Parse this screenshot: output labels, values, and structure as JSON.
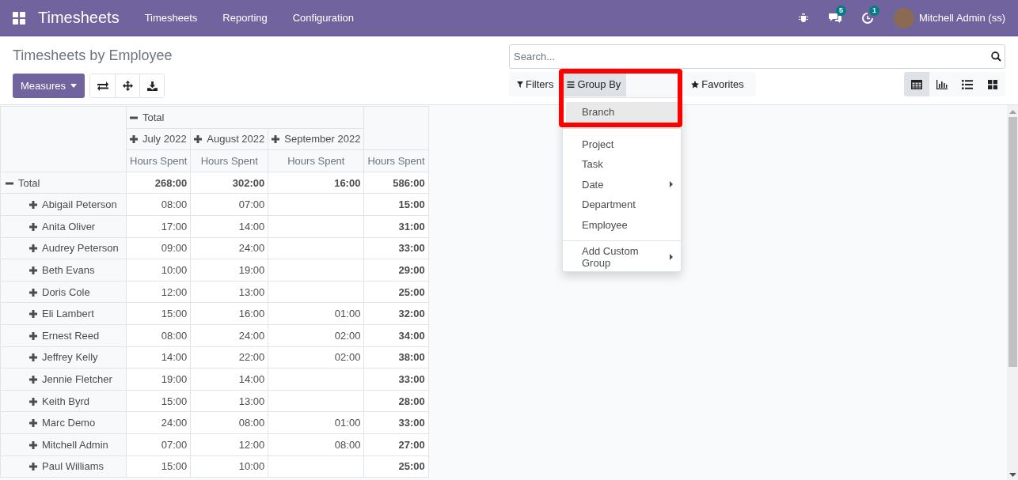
{
  "navbar": {
    "app_title": "Timesheets",
    "menus": [
      "Timesheets",
      "Reporting",
      "Configuration"
    ],
    "messages_badge": "5",
    "activities_badge": "1",
    "user": "Mitchell Admin (ss)"
  },
  "control_panel": {
    "title": "Timesheets by Employee",
    "measures_button": "Measures",
    "search": {
      "placeholder": "Search..."
    },
    "search_options": [
      {
        "kind": "filter",
        "label": "Filters",
        "selected": false
      },
      {
        "kind": "groupby",
        "label": "Group By",
        "selected": true
      },
      {
        "kind": "favorite",
        "label": "Favorites",
        "selected": false
      }
    ],
    "views": [
      {
        "kind": "pivot",
        "selected": true
      },
      {
        "kind": "graph",
        "selected": false
      },
      {
        "kind": "list",
        "selected": false
      },
      {
        "kind": "kanban",
        "selected": false
      }
    ]
  },
  "group_by_menu": {
    "groups": [
      [
        {
          "label": "Branch",
          "selected": true,
          "has_submenu": false
        }
      ],
      [
        {
          "label": "Project",
          "selected": false,
          "has_submenu": false
        },
        {
          "label": "Task",
          "selected": false,
          "has_submenu": false
        },
        {
          "label": "Date",
          "selected": false,
          "has_submenu": true
        },
        {
          "label": "Department",
          "selected": false,
          "has_submenu": false
        },
        {
          "label": "Employee",
          "selected": false,
          "has_submenu": false
        }
      ],
      [
        {
          "label": "Add Custom Group",
          "selected": false,
          "has_submenu": true
        }
      ]
    ]
  },
  "pivot": {
    "column_total": {
      "label": "Total",
      "expanded": true
    },
    "columns": [
      {
        "label": "July 2022",
        "expanded": false
      },
      {
        "label": "August 2022",
        "expanded": false
      },
      {
        "label": "September 2022",
        "expanded": false
      }
    ],
    "measure_headers": [
      "Hours Spent",
      "Hours Spent",
      "Hours Spent",
      "Hours Spent"
    ],
    "total_row": {
      "label": "Total",
      "expanded": true,
      "july_2022": "268:00",
      "august_2022": "302:00",
      "september_2022": "16:00",
      "total": "586:00"
    },
    "rows": [
      {
        "label": "Abigail Peterson",
        "expanded": false,
        "july_2022": "08:00",
        "august_2022": "07:00",
        "total": "15:00"
      },
      {
        "label": "Anita Oliver",
        "expanded": false,
        "july_2022": "17:00",
        "august_2022": "14:00",
        "total": "31:00"
      },
      {
        "label": "Audrey Peterson",
        "expanded": false,
        "july_2022": "09:00",
        "august_2022": "24:00",
        "total": "33:00"
      },
      {
        "label": "Beth Evans",
        "expanded": false,
        "july_2022": "10:00",
        "august_2022": "19:00",
        "total": "29:00"
      },
      {
        "label": "Doris Cole",
        "expanded": false,
        "july_2022": "12:00",
        "august_2022": "13:00",
        "total": "25:00"
      },
      {
        "label": "Eli Lambert",
        "expanded": false,
        "july_2022": "15:00",
        "august_2022": "16:00",
        "september_2022": "01:00",
        "total": "32:00"
      },
      {
        "label": "Ernest Reed",
        "expanded": false,
        "july_2022": "08:00",
        "august_2022": "24:00",
        "september_2022": "02:00",
        "total": "34:00"
      },
      {
        "label": "Jeffrey Kelly",
        "expanded": false,
        "july_2022": "14:00",
        "august_2022": "22:00",
        "september_2022": "02:00",
        "total": "38:00"
      },
      {
        "label": "Jennie Fletcher",
        "expanded": false,
        "july_2022": "19:00",
        "august_2022": "14:00",
        "total": "33:00"
      },
      {
        "label": "Keith Byrd",
        "expanded": false,
        "july_2022": "15:00",
        "august_2022": "13:00",
        "total": "28:00"
      },
      {
        "label": "Marc Demo",
        "expanded": false,
        "july_2022": "24:00",
        "august_2022": "08:00",
        "september_2022": "01:00",
        "total": "33:00"
      },
      {
        "label": "Mitchell Admin",
        "expanded": false,
        "july_2022": "07:00",
        "august_2022": "12:00",
        "september_2022": "08:00",
        "total": "27:00"
      },
      {
        "label": "Paul Williams",
        "expanded": false,
        "july_2022": "15:00",
        "august_2022": "10:00",
        "total": "25:00"
      }
    ]
  }
}
